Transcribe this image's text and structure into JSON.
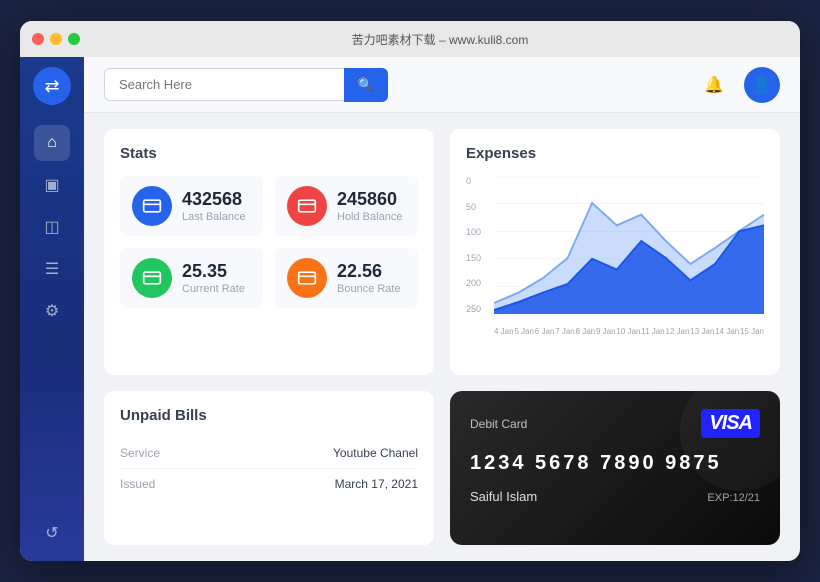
{
  "titlebar": {
    "title": "苦力吧素材下载 – www.kuli8.com"
  },
  "sidebar": {
    "logo_icon": "⇄",
    "items": [
      {
        "id": "home",
        "icon": "⌂",
        "active": true
      },
      {
        "id": "folder",
        "icon": "▣"
      },
      {
        "id": "layers",
        "icon": "◫"
      },
      {
        "id": "document",
        "icon": "☰"
      },
      {
        "id": "settings",
        "icon": "⚙"
      },
      {
        "id": "refresh",
        "icon": "↺"
      }
    ]
  },
  "header": {
    "search_placeholder": "Search Here",
    "search_icon": "🔍",
    "notification_icon": "🔔",
    "avatar_icon": "👤"
  },
  "stats": {
    "title": "Stats",
    "items": [
      {
        "id": "last-balance",
        "value": "432568",
        "label": "Last Balance",
        "icon": "💳",
        "color": "blue"
      },
      {
        "id": "hold-balance",
        "value": "245860",
        "label": "Hold Balance",
        "icon": "💳",
        "color": "red"
      },
      {
        "id": "current-rate",
        "value": "25.35",
        "label": "Current Rate",
        "icon": "💳",
        "color": "green"
      },
      {
        "id": "bounce-rate",
        "value": "22.56",
        "label": "Bounce Rate",
        "icon": "💳",
        "color": "orange"
      }
    ]
  },
  "expenses": {
    "title": "Expenses",
    "y_labels": [
      "250",
      "200",
      "150",
      "100",
      "50",
      "0"
    ],
    "x_labels": [
      "4 Jan",
      "5 Jan",
      "6 Jan",
      "7 Jan",
      "8 Jan",
      "9 Jan",
      "10 Jan",
      "11 Jan",
      "12 Jan",
      "13 Jan",
      "14 Jan",
      "15 Jan"
    ],
    "light_series": [
      20,
      60,
      90,
      120,
      180,
      140,
      160,
      110,
      80,
      100,
      130,
      150
    ],
    "dark_series": [
      10,
      30,
      50,
      70,
      100,
      80,
      110,
      90,
      60,
      80,
      120,
      140
    ],
    "colors": {
      "light": "#7ba7f5",
      "dark": "#1a56e8"
    }
  },
  "bills": {
    "title": "Unpaid Bills",
    "rows": [
      {
        "label": "Service",
        "value": "Youtube Chanel"
      },
      {
        "label": "Issued",
        "value": "March 17, 2021"
      }
    ]
  },
  "debit_card": {
    "label": "Debit Card",
    "visa_text": "VISA",
    "number": "1234  5678  7890  9875",
    "holder": "Saiful Islam",
    "expiry": "EXP:12/21"
  }
}
